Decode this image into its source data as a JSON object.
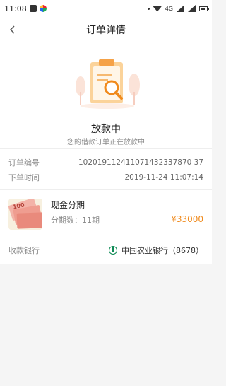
{
  "status_bar": {
    "time": "11:08",
    "network": "4G"
  },
  "nav": {
    "title": "订单详情"
  },
  "status": {
    "title": "放款中",
    "subtitle": "您的借款订单正在放款中"
  },
  "order": {
    "number_label": "订单编号",
    "number": "102019112411071432337870 37",
    "time_label": "下单时间",
    "time": "2019-11-24 11:07:14"
  },
  "product": {
    "name": "现金分期",
    "periods": "分期数：11期",
    "amount": "¥33000",
    "thumb_text": "100"
  },
  "bank": {
    "label": "收款银行",
    "name": "中国农业银行（8678）"
  },
  "colors": {
    "accent": "#f08a1c",
    "bank_green": "#0e8a55"
  }
}
